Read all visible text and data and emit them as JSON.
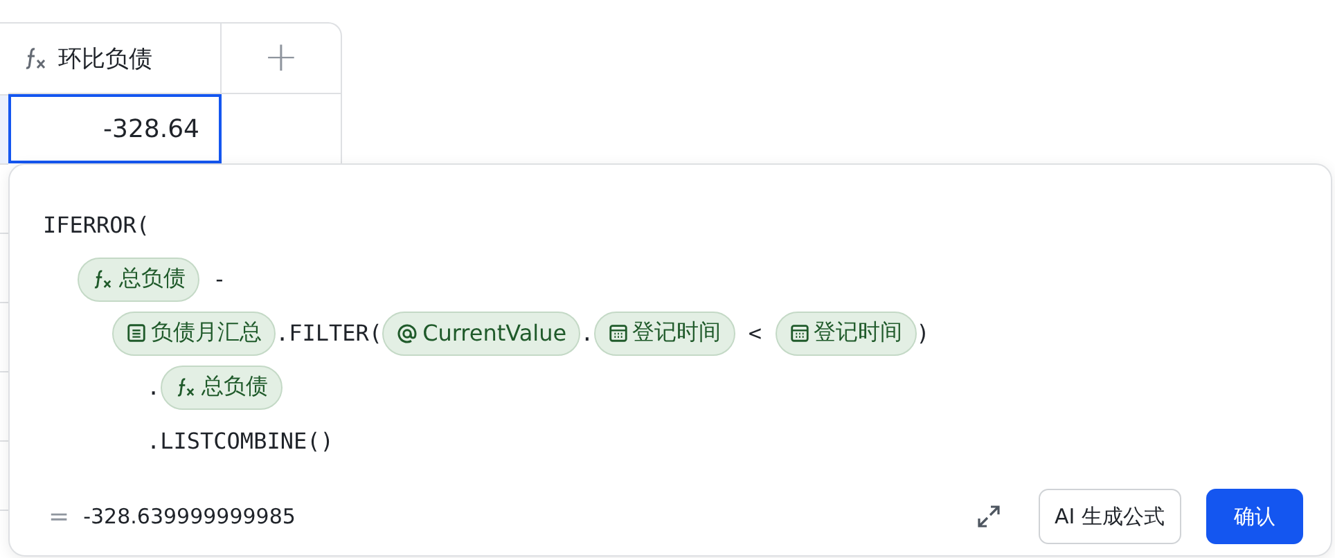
{
  "table": {
    "columns": [
      {
        "label": "环比负债",
        "kind": "formula"
      },
      {
        "label": "+",
        "kind": "add"
      }
    ],
    "cell": {
      "value": "-328.64",
      "selected": true
    }
  },
  "editor": {
    "lines": [
      {
        "tokens": [
          {
            "kind": "text",
            "text": "IFERROR("
          }
        ],
        "children": [
          {
            "tokens": [
              {
                "kind": "formula",
                "text": "总负债"
              },
              {
                "kind": "text",
                "text": " -"
              }
            ],
            "children": [
              {
                "tokens": [
                  {
                    "kind": "table",
                    "text": "负债月汇总"
                  },
                  {
                    "kind": "text",
                    "text": ".FILTER("
                  },
                  {
                    "kind": "mention",
                    "text": "CurrentValue"
                  },
                  {
                    "kind": "text",
                    "text": "."
                  },
                  {
                    "kind": "date",
                    "text": "登记时间"
                  },
                  {
                    "kind": "text",
                    "text": " < "
                  },
                  {
                    "kind": "date",
                    "text": "登记时间"
                  },
                  {
                    "kind": "text",
                    "text": ")"
                  }
                ],
                "children": [
                  {
                    "tokens": [
                      {
                        "kind": "text",
                        "text": "."
                      },
                      {
                        "kind": "formula",
                        "text": "总负债"
                      }
                    ]
                  },
                  {
                    "tokens": [
                      {
                        "kind": "text",
                        "text": ".LISTCOMBINE()"
                      }
                    ]
                  }
                ]
              }
            ]
          }
        ]
      }
    ],
    "result": {
      "sign": "=",
      "value": "-328.639999999985"
    },
    "buttons": [
      {
        "label": "AI 生成公式",
        "kind": "secondary"
      },
      {
        "label": "确认",
        "kind": "primary"
      }
    ]
  }
}
